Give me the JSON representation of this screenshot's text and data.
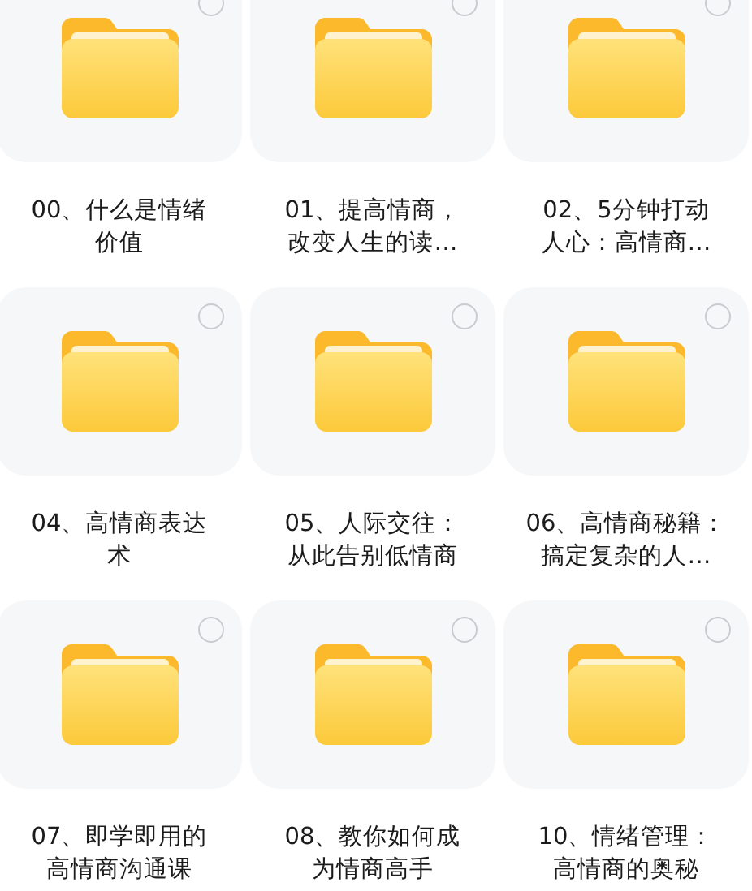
{
  "folders": [
    {
      "lines": [
        "00、什么是情绪",
        "价值"
      ],
      "selected": false
    },
    {
      "lines": [
        "01、提高情商，",
        "改变人生的读…"
      ],
      "selected": false
    },
    {
      "lines": [
        "02、5分钟打动",
        "人心：高情商…"
      ],
      "selected": false
    },
    {
      "lines": [
        "04、高情商表达",
        "术"
      ],
      "selected": false
    },
    {
      "lines": [
        "05、人际交往：",
        "从此告别低情商"
      ],
      "selected": false
    },
    {
      "lines": [
        "06、高情商秘籍：",
        "搞定复杂的人…"
      ],
      "selected": false
    },
    {
      "lines": [
        "07、即学即用的",
        "高情商沟通课"
      ],
      "selected": false
    },
    {
      "lines": [
        "08、教你如何成",
        "为情商高手"
      ],
      "selected": false
    },
    {
      "lines": [
        "10、情绪管理：",
        "高情商的奥秘"
      ],
      "selected": false
    }
  ]
}
